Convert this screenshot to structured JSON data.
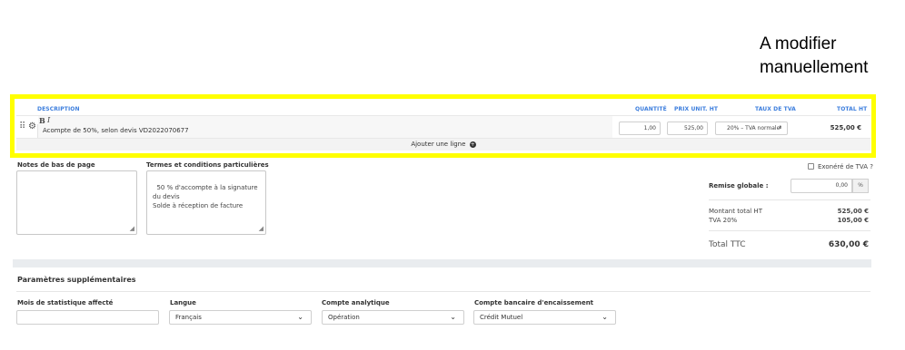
{
  "annotation": {
    "line1": "A modifier",
    "line2": "manuellement"
  },
  "table": {
    "headers": {
      "description": "DESCRIPTION",
      "quantity": "QUANTITÉ",
      "unit_price": "PRIX UNIT. HT",
      "vat_rate": "TAUX DE TVA",
      "total": "TOTAL HT"
    },
    "row": {
      "bold_btn": "B",
      "italic_btn": "I",
      "description": "Acompte de 50%, selon devis VD2022070677",
      "quantity": "1,00",
      "unit_price": "525,00",
      "vat_rate": "20% – TVA normale",
      "total": "525,00 €"
    },
    "add_line_label": "Ajouter une ligne"
  },
  "notes": {
    "footer_label": "Notes de bas de page",
    "footer_value": "",
    "terms_label": "Termes et conditions particulières",
    "terms_value": "50 % d'accompte à la signature du devis\nSolde à réception de facture"
  },
  "summary": {
    "vat_exempt_label": "Exonéré de TVA ?",
    "discount_label": "Remise globale :",
    "discount_value": "0,00",
    "discount_unit": "%",
    "total_ht_label": "Montant total HT",
    "total_ht_value": "525,00 €",
    "vat_label": "TVA 20%",
    "vat_value": "105,00 €",
    "ttc_label": "Total TTC",
    "ttc_value": "630,00 €"
  },
  "params": {
    "title": "Paramètres supplémentaires",
    "stat_month_label": "Mois de statistique affecté",
    "stat_month_value": "",
    "language_label": "Langue",
    "language_value": "Français",
    "analytic_label": "Compte analytique",
    "analytic_value": "Opération",
    "bank_label": "Compte bancaire d'encaissement",
    "bank_value": "Crédit Mutuel"
  },
  "colors": {
    "highlight": "#ffff00",
    "header_blue": "#3b7ddd"
  }
}
